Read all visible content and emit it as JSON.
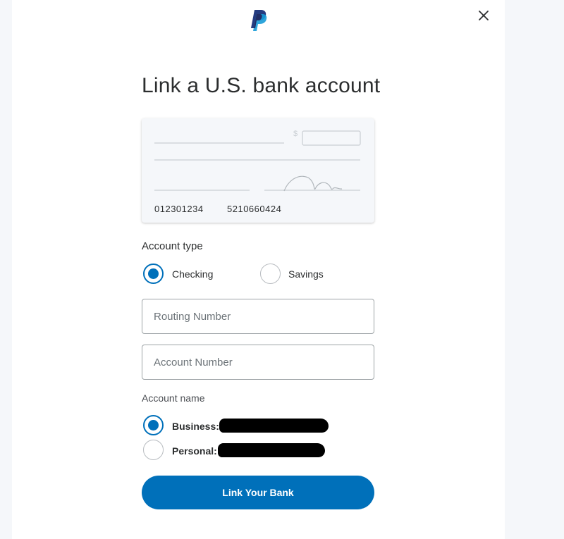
{
  "header": {
    "logo": "paypal-logo-icon",
    "close_icon": "close-icon"
  },
  "title": "Link a U.S. bank account",
  "check": {
    "currency_symbol": "$",
    "routing_number": "012301234",
    "account_number": "5210660424"
  },
  "account_type": {
    "label": "Account type",
    "options": [
      {
        "label": "Checking",
        "selected": true
      },
      {
        "label": "Savings",
        "selected": false
      }
    ]
  },
  "fields": {
    "routing_placeholder": "Routing Number",
    "routing_value": "",
    "account_placeholder": "Account Number",
    "account_value": ""
  },
  "account_name": {
    "label": "Account name",
    "options": [
      {
        "label": "Business:",
        "selected": true
      },
      {
        "label": "Personal:",
        "selected": false
      }
    ]
  },
  "button": {
    "label": "Link Your Bank"
  },
  "colors": {
    "accent": "#0070ba",
    "paypal_dark": "#253b80",
    "paypal_light": "#179bd7",
    "text": "#2c2e2f",
    "page_bg": "#f5f7fa"
  }
}
